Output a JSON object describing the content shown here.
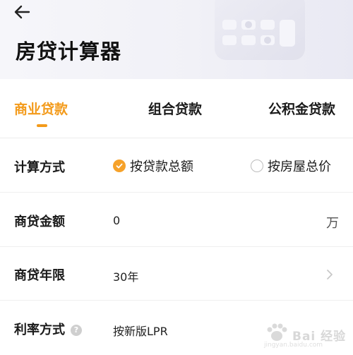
{
  "header": {
    "title": "房贷计算器",
    "back_icon": "arrow-left-icon"
  },
  "tabs": [
    {
      "label": "商业贷款",
      "active": true
    },
    {
      "label": "组合贷款",
      "active": false
    },
    {
      "label": "公积金贷款",
      "active": false
    }
  ],
  "colors": {
    "accent": "#f39a1a",
    "header_bg": "#f3f3f8"
  },
  "form": {
    "calc_method": {
      "label": "计算方式",
      "options": [
        {
          "label": "按贷款总额",
          "checked": true
        },
        {
          "label": "按房屋总价",
          "checked": false
        }
      ]
    },
    "loan_amount": {
      "label": "商贷金额",
      "value": "0",
      "unit": "万"
    },
    "loan_term": {
      "label": "商贷年限",
      "value": "30年"
    },
    "rate_method": {
      "label": "利率方式",
      "value": "按新版LPR"
    }
  },
  "watermark": {
    "text": "Bai 经验",
    "url": "jingyan.baidu.com"
  }
}
